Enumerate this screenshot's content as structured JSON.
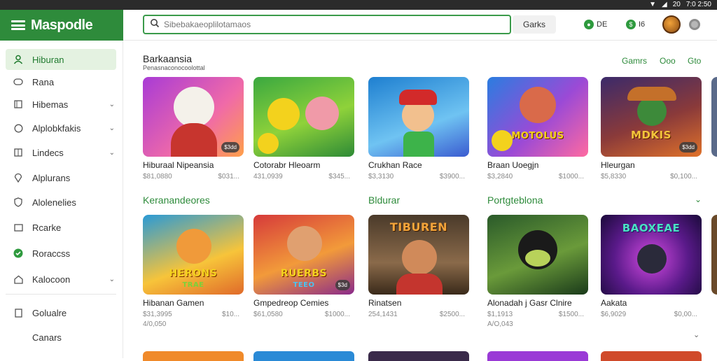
{
  "status_bar": {
    "icons": [
      "wifi-icon",
      "signal-icon"
    ],
    "battery": "20",
    "time": "7:0 2:50"
  },
  "app": {
    "brand": "Maspodle"
  },
  "search": {
    "placeholder": "Sibebakaeoplilotamaos",
    "button_label": "Garks"
  },
  "top_actions": [
    {
      "icon": "gamepad-icon",
      "label": "DE"
    },
    {
      "icon": "coin-icon",
      "label": "I6"
    }
  ],
  "sidebar": {
    "items": [
      {
        "label": "Hiburan",
        "icon": "user-icon",
        "active": true,
        "chevron": false
      },
      {
        "label": "Rana",
        "icon": "controller-icon",
        "active": false,
        "chevron": false
      },
      {
        "label": "Hibemas",
        "icon": "grid-icon",
        "active": false,
        "chevron": true
      },
      {
        "label": "Alplobkfakis",
        "icon": "globe-icon",
        "active": false,
        "chevron": true
      },
      {
        "label": "Lindecs",
        "icon": "grid-icon",
        "active": false,
        "chevron": true
      },
      {
        "label": "Alplurans",
        "icon": "pin-icon",
        "active": false,
        "chevron": false
      },
      {
        "label": "Alolenelies",
        "icon": "shield-icon",
        "active": false,
        "chevron": false
      },
      {
        "label": "Rcarke",
        "icon": "box-icon",
        "active": false,
        "chevron": false
      },
      {
        "label": "Roraccss",
        "icon": "check-icon",
        "active": false,
        "chevron": false
      },
      {
        "label": "Kalocoon",
        "icon": "home-icon",
        "active": false,
        "chevron": true
      },
      {
        "label": "Golualre",
        "icon": "doc-icon",
        "active": false,
        "chevron": false
      },
      {
        "label": "Canars",
        "icon": "",
        "active": false,
        "chevron": false
      }
    ]
  },
  "section1": {
    "title": "Barkaansia",
    "subtitle": "Penasnaconocoolottal",
    "filters": [
      "Gamrs",
      "Ooo",
      "Gto"
    ],
    "cards": [
      {
        "name": "Hiburaal Nipeansia",
        "price": "$81,0880",
        "count": "$031...",
        "badge": "$3dd"
      },
      {
        "name": "Cotorabr Hleoarm",
        "price": "431,0939",
        "count": "$345...",
        "badge": ""
      },
      {
        "name": "Crukhan Race",
        "price": "$3,3130",
        "count": "$3900...",
        "badge": ""
      },
      {
        "name": "Braan Uoegjn",
        "price": "$3,2840",
        "count": "$1000...",
        "badge": ""
      },
      {
        "name": "Hleurgan",
        "price": "$5,8330",
        "count": "$0,100...",
        "badge": "$3dd",
        "art": "MDKIS"
      }
    ]
  },
  "categories": [
    {
      "title": "Keranandeores",
      "chevron": false
    },
    {
      "title": "Bldurar",
      "chevron": false
    },
    {
      "title": "Portgteblona",
      "chevron": true
    }
  ],
  "section2": {
    "cards": [
      {
        "name": "Hibanan Gamen",
        "price": "$31,3995",
        "count": "$10...",
        "extra": "4/0,050",
        "art": "HERONS",
        "art2": "TRAE"
      },
      {
        "name": "Gmpedreop Cemies",
        "price": "$61,0580",
        "count": "$1000...",
        "extra": "",
        "art": "RUERBS",
        "art2": "TEEO",
        "badge": "$3d"
      },
      {
        "name": "Rinatsen",
        "price": "254,1431",
        "count": "$2500...",
        "extra": "",
        "art": "TIBUREN"
      },
      {
        "name": "Alonadah j Gasr Clnire",
        "price": "$1,1913",
        "count": "$1500...",
        "extra": "A/O,043"
      },
      {
        "name": "Aakata",
        "price": "$6,9029",
        "count": "$0,00...",
        "extra": "",
        "art": "BAOXEAE"
      }
    ]
  },
  "colors": {
    "accent": "#2e8b3b",
    "active_bg": "#e4f2e1"
  }
}
